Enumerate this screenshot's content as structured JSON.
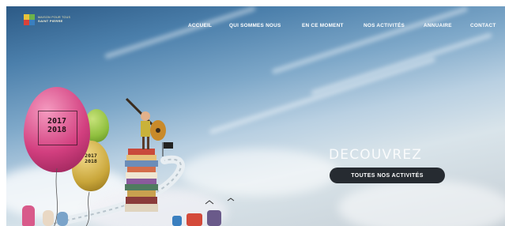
{
  "site": {
    "logo_line1": "MAISON POUR TOUS",
    "logo_line2": "SAINT PIERRE"
  },
  "nav": {
    "items": [
      {
        "label": "ACCUEIL"
      },
      {
        "label": "QUI SOMMES NOUS"
      },
      {
        "label": "EN CE MOMENT"
      },
      {
        "label": "NOS ACTIVITÉS"
      },
      {
        "label": "ANNUAIRE"
      },
      {
        "label": "CONTACT"
      }
    ]
  },
  "hero": {
    "title": "DECOUVREZ",
    "cta_label": "TOUTES NOS ACTIVITÉS",
    "balloon_pink_text": "2017\n2018",
    "balloon_yellow_text": "2017\n2018"
  },
  "colors": {
    "cta_background": "#262b31",
    "balloon_pink": "#d23f7f",
    "balloon_yellow": "#c9a63a",
    "balloon_green": "#8fbf3e"
  }
}
